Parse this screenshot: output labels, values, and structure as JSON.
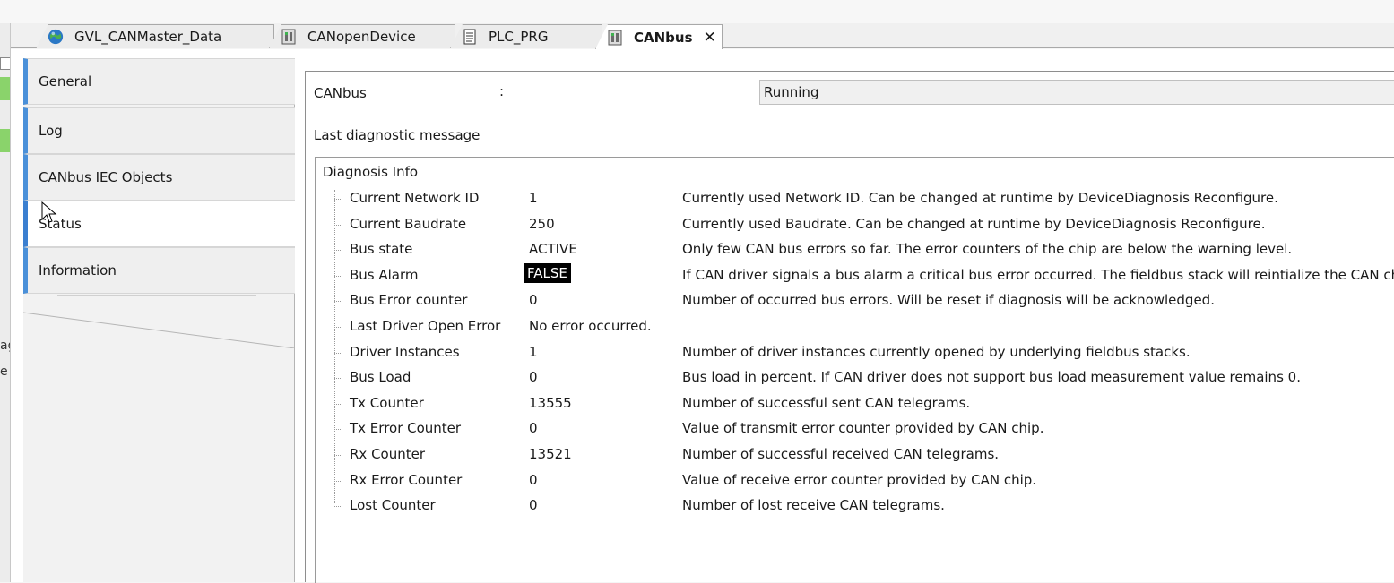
{
  "left_panel_fragments": [
    "ag",
    "e"
  ],
  "tabs": [
    {
      "label": "GVL_CANMaster_Data",
      "icon": "globe-icon"
    },
    {
      "label": "CANopenDevice",
      "icon": "device-icon"
    },
    {
      "label": "PLC_PRG",
      "icon": "document-icon"
    },
    {
      "label": "CANbus",
      "icon": "device-icon",
      "close": "✕"
    }
  ],
  "nav": {
    "items": [
      {
        "label": "General"
      },
      {
        "label": "Log"
      },
      {
        "label": "CANbus IEC Objects"
      },
      {
        "label": "Status"
      },
      {
        "label": "Information"
      }
    ]
  },
  "status": {
    "name_label": "CANbus",
    "colon": ":",
    "value": "Running",
    "last_diag_label": "Last diagnostic message"
  },
  "diagnosis": {
    "title": "Diagnosis Info",
    "rows": [
      {
        "name": "Current Network ID",
        "value": "1",
        "desc": "Currently used Network ID. Can be changed at runtime by DeviceDiagnosis Reconfigure."
      },
      {
        "name": "Current Baudrate",
        "value": "250",
        "desc": "Currently used Baudrate. Can be changed at runtime by DeviceDiagnosis Reconfigure."
      },
      {
        "name": "Bus state",
        "value": "ACTIVE",
        "desc": "Only few CAN bus errors so far. The error counters of the chip are below the warning level."
      },
      {
        "name": "Bus Alarm",
        "value": "FALSE",
        "desc": "If CAN driver signals a bus alarm a critical bus error occurred. The fieldbus stack will reintialize the CAN chip."
      },
      {
        "name": "Bus Error counter",
        "value": "0",
        "desc": "Number of occurred bus errors. Will be reset if diagnosis will be acknowledged."
      },
      {
        "name": "Last Driver Open Error",
        "value": "No error occurred.",
        "desc": ""
      },
      {
        "name": "Driver Instances",
        "value": "1",
        "desc": "Number of driver instances currently opened by underlying fieldbus stacks."
      },
      {
        "name": "Bus Load",
        "value": "0",
        "desc": "Bus load in percent. If CAN driver does not support bus load measurement value remains 0."
      },
      {
        "name": "Tx Counter",
        "value": "13555",
        "desc": "Number of successful sent CAN telegrams."
      },
      {
        "name": "Tx Error Counter",
        "value": "0",
        "desc": "Value of transmit error counter provided by CAN chip."
      },
      {
        "name": "Rx Counter",
        "value": "13521",
        "desc": "Number of successful received CAN telegrams."
      },
      {
        "name": "Rx Error Counter",
        "value": "0",
        "desc": "Value of receive error counter provided by CAN chip."
      },
      {
        "name": "Lost Counter",
        "value": "0",
        "desc": "Number of lost receive CAN telegrams."
      }
    ]
  }
}
